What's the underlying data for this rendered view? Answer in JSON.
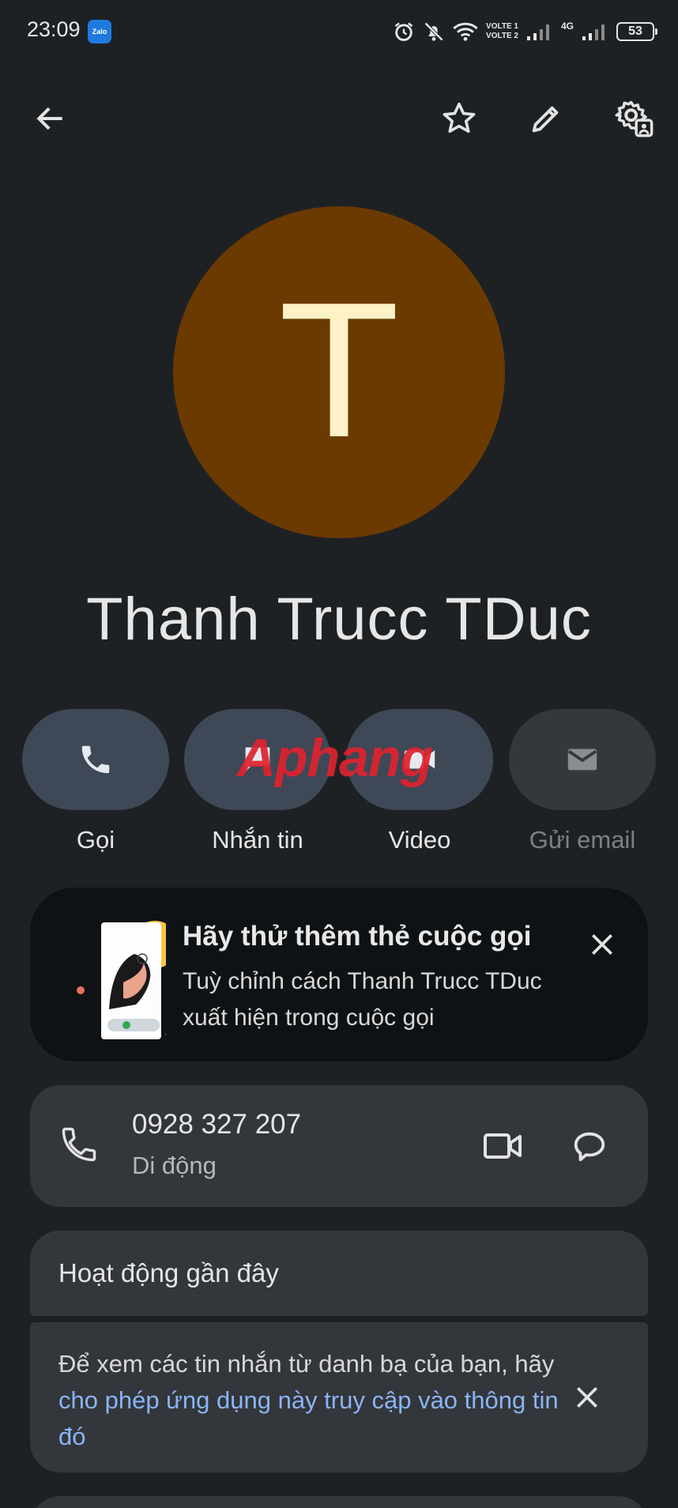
{
  "status_bar": {
    "time": "23:09",
    "notification_app": "Zalo",
    "volte1": "VOLTE 1",
    "volte2": "VOLTE 2",
    "network": "4G",
    "battery": "53"
  },
  "app_bar": {
    "back_icon": "arrow-left-icon",
    "star_icon": "star-outline-icon",
    "edit_icon": "pencil-icon",
    "settings_icon": "gear-person-icon"
  },
  "contact": {
    "initial": "T",
    "name": "Thanh Trucc TDuc",
    "avatar_color": "#6b3a00"
  },
  "actions": [
    {
      "label": "Gọi",
      "icon": "phone-icon",
      "enabled": true
    },
    {
      "label": "Nhắn tin",
      "icon": "message-icon",
      "enabled": true
    },
    {
      "label": "Video",
      "icon": "video-icon",
      "enabled": true
    },
    {
      "label": "Gửi email",
      "icon": "email-icon",
      "enabled": false
    }
  ],
  "watermark": {
    "red": "Aphang",
    "blue": ""
  },
  "promo_card": {
    "title": "Hãy thử thêm thẻ cuộc gọi",
    "text": "Tuỳ chỉnh cách Thanh Trucc TDuc xuất hiện trong cuộc gọi"
  },
  "phone_entry": {
    "number": "0928 327 207",
    "type": "Di động"
  },
  "recent_activity": {
    "title": "Hoạt động gần đây",
    "text_before": "Để xem các tin nhắn từ danh bạ của bạn, hãy ",
    "link": "cho phép ứng dụng này truy cập vào thông tin đó"
  },
  "colors": {
    "background": "#1e2124",
    "card": "#33363a",
    "action_pill": "#3e4856",
    "link": "#8ab4f8"
  }
}
